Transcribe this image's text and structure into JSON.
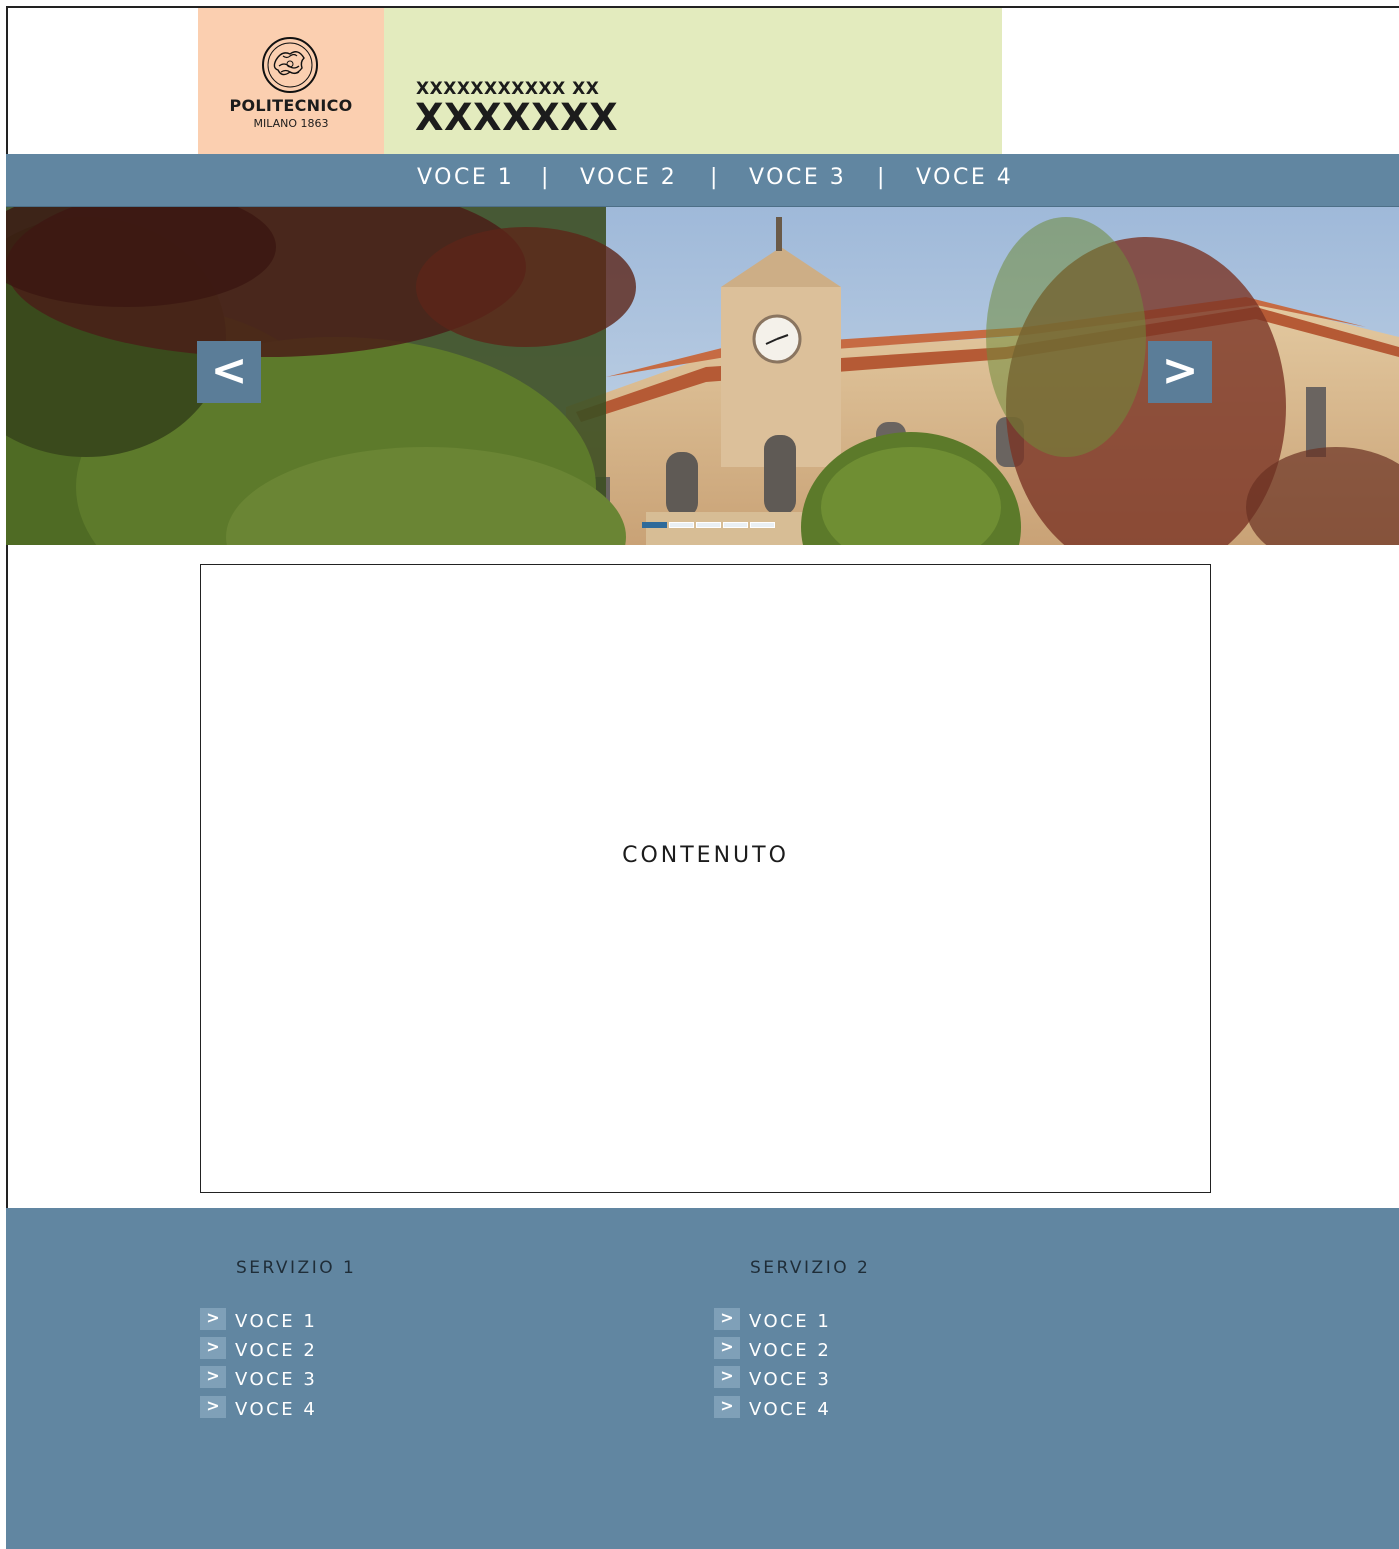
{
  "colors": {
    "logo_bg": "#fbcfb0",
    "title_bg": "#e3ebbe",
    "nav_bg": "#6186a1",
    "arrow_bg": "#5b7d98",
    "footer_bg": "#6186a1",
    "active_dot": "#2f6a9a"
  },
  "header": {
    "logo_icon": "university-seal",
    "logo_name": "POLITECNICO",
    "logo_sub": "MILANO 1863",
    "subtitle": "XXXXXXXXXXX XX",
    "title": "XXXXXXX"
  },
  "nav": {
    "items": [
      "VOCE 1",
      "VOCE 2",
      "VOCE 3",
      "VOCE 4"
    ],
    "separator": "|"
  },
  "hero": {
    "image": "campus-building-with-clock-tower-photo",
    "prev_label": "<",
    "next_label": ">",
    "slide_count": 5,
    "active_slide": 1
  },
  "content": {
    "label": "CONTENUTO"
  },
  "footer": {
    "services": [
      {
        "title": "SERVIZIO 1",
        "items": [
          "VOCE 1",
          "VOCE 2",
          "VOCE 3",
          "VOCE 4"
        ],
        "arrow": ">"
      },
      {
        "title": "SERVIZIO 2",
        "items": [
          "VOCE 1",
          "VOCE 2",
          "VOCE 3",
          "VOCE 4"
        ],
        "arrow": ">"
      }
    ]
  }
}
